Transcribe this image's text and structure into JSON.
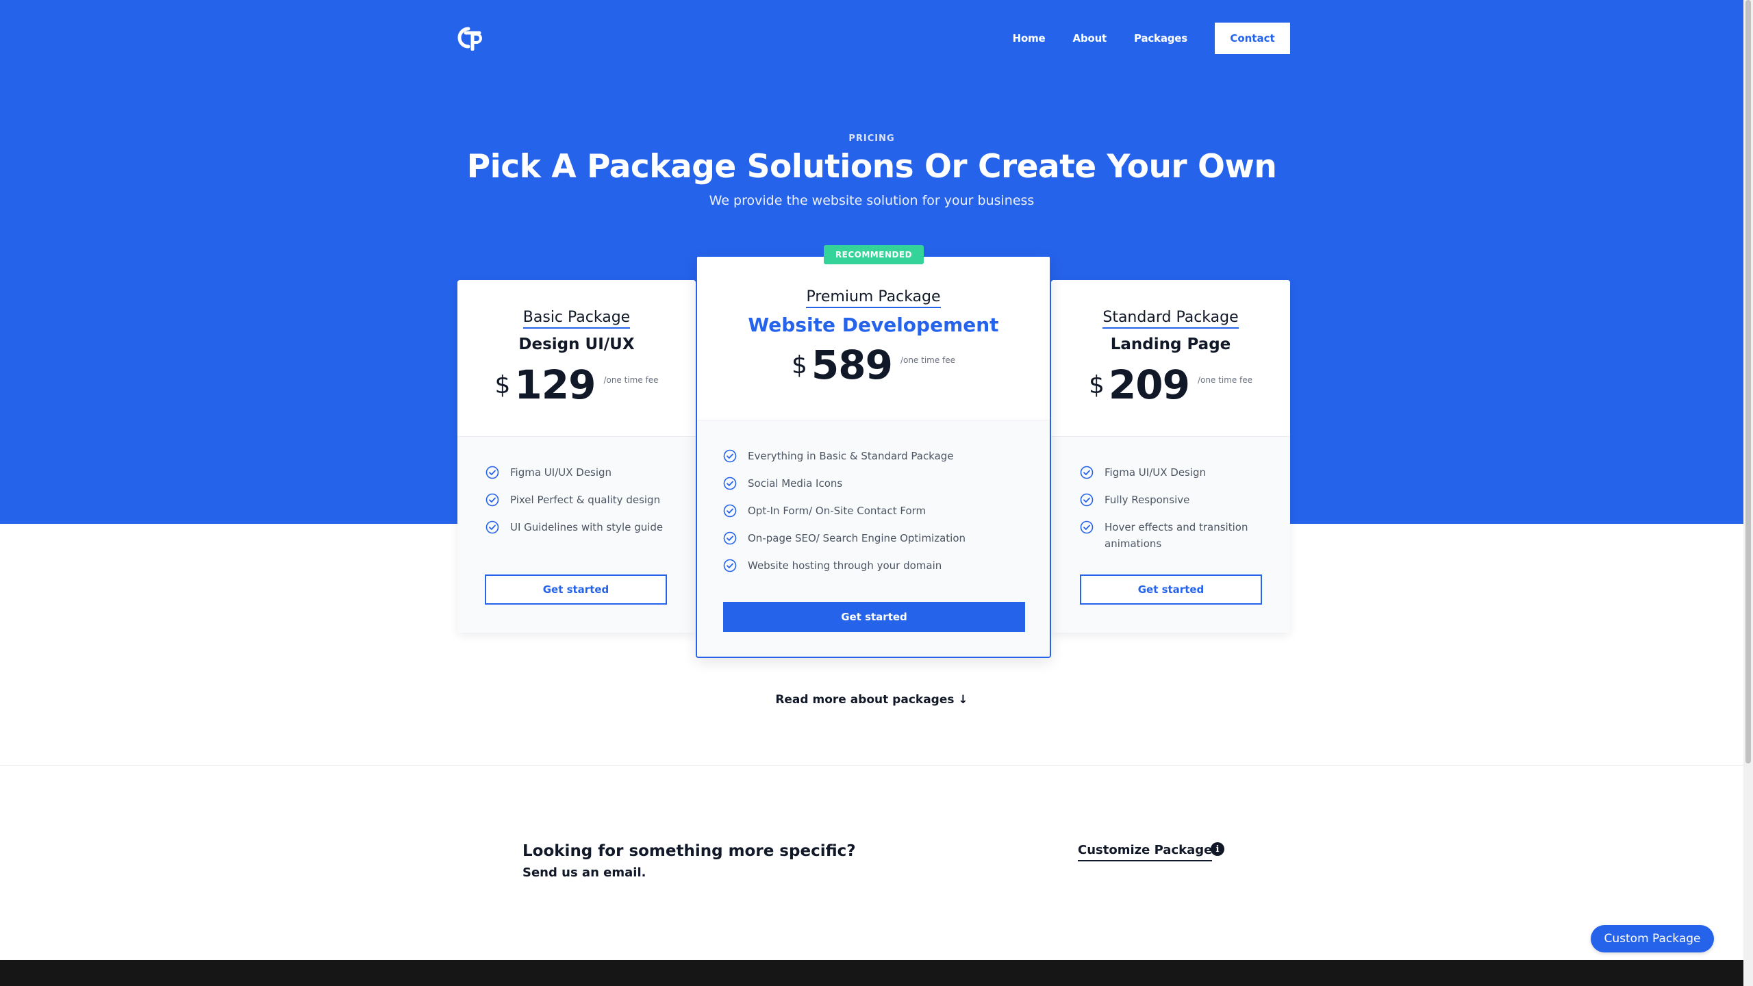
{
  "colors": {
    "brand_blue": "#2563eb",
    "badge_green": "#34d399",
    "footer_dark": "#161616"
  },
  "nav": {
    "logo_icon": "ct-logo-icon",
    "links": [
      "Home",
      "About",
      "Packages"
    ],
    "contact_label": "Contact"
  },
  "hero": {
    "eyebrow": "PRICING",
    "title": "Pick A Package Solutions Or Create Your Own",
    "subtitle": "We provide the website solution for your business"
  },
  "packages": [
    {
      "name": "Basic Package",
      "subtitle": "Design UI/UX",
      "currency": "$",
      "price": "129",
      "fee_note": "/one time fee",
      "features": [
        "Figma UI/UX Design",
        "Pixel Perfect & quality design",
        "UI Guidelines with style guide"
      ],
      "cta": "Get started"
    },
    {
      "badge": "RECOMMENDED",
      "name": "Premium Package",
      "subtitle": "Website Developement",
      "currency": "$",
      "price": "589",
      "fee_note": "/one time fee",
      "features": [
        "Everything in Basic & Standard Package",
        "Social Media Icons",
        "Opt-In Form/ On-Site Contact Form",
        "On-page SEO/ Search Engine Optimization",
        "Website hosting through your domain"
      ],
      "cta": "Get started"
    },
    {
      "name": "Standard Package",
      "subtitle": "Landing Page",
      "currency": "$",
      "price": "209",
      "fee_note": "/one time fee",
      "features": [
        "Figma UI/UX Design",
        "Fully Responsive",
        "Hover effects and transition animations"
      ],
      "cta": "Get started"
    }
  ],
  "read_more": "Read more about packages ↓",
  "specific": {
    "title": "Looking for something more specific?",
    "subtitle": "Send us an email.",
    "customize_label": "Customize Package",
    "info_icon": "info-icon"
  },
  "floating_button": "Custom Package"
}
